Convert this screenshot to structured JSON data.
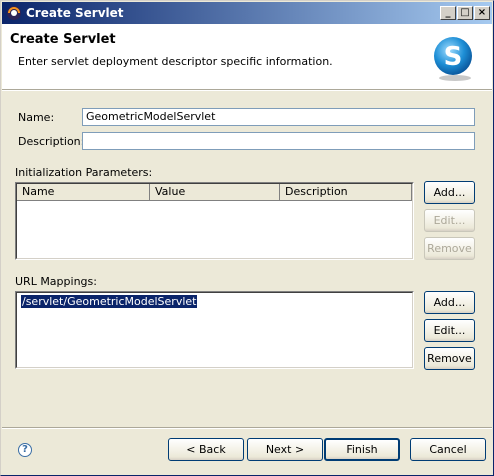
{
  "window": {
    "title": "Create Servlet"
  },
  "titlebar_buttons": {
    "minimize": "_",
    "maximize": "□",
    "close": "×"
  },
  "header": {
    "title": "Create Servlet",
    "description": "Enter servlet deployment descriptor specific information."
  },
  "form": {
    "name_label": "Name:",
    "name_value": "GeometricModelServlet",
    "description_label": "Description:",
    "description_value": ""
  },
  "init_params": {
    "label": "Initialization Parameters:",
    "columns": [
      "Name",
      "Value",
      "Description"
    ],
    "rows": [],
    "buttons": {
      "add": "Add...",
      "edit": "Edit...",
      "remove": "Remove"
    }
  },
  "url_mappings": {
    "label": "URL Mappings:",
    "items": [
      "/servlet/GeometricModelServlet"
    ],
    "buttons": {
      "add": "Add...",
      "edit": "Edit...",
      "remove": "Remove"
    }
  },
  "footer": {
    "help_icon": "?",
    "back": "< Back",
    "next": "Next >",
    "finish": "Finish",
    "cancel": "Cancel"
  },
  "icons": [
    "window-icon",
    "servlet-logo-icon",
    "help-icon"
  ],
  "colors": {
    "titlebar_start": "#0a246a",
    "titlebar_end": "#a6caf0",
    "selection": "#0a246a"
  }
}
